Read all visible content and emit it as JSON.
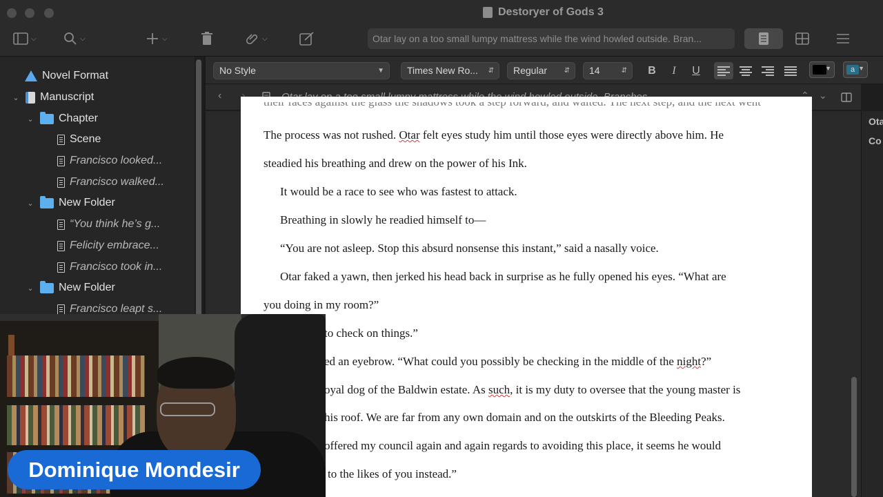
{
  "window": {
    "title": "Destoryer of Gods 3",
    "search_text": "Otar lay on a too small lumpy mattress while the wind howled outside. Bran..."
  },
  "toolbar": {
    "icons": [
      "sidebar-icon",
      "search-icon",
      "add-icon",
      "trash-icon",
      "paperclip-icon",
      "compose-icon",
      "document-view-icon",
      "grid-view-icon",
      "outline-view-icon"
    ]
  },
  "binder": {
    "items": [
      {
        "label": "Novel Format",
        "kind": "format"
      },
      {
        "label": "Manuscript",
        "kind": "manuscript"
      },
      {
        "label": "Chapter",
        "kind": "folder"
      },
      {
        "label": "Scene",
        "kind": "page"
      },
      {
        "label": "Francisco looked...",
        "kind": "page"
      },
      {
        "label": "Francisco walked...",
        "kind": "page"
      },
      {
        "label": "New Folder",
        "kind": "folder"
      },
      {
        "label": "“You think he’s g...",
        "kind": "page"
      },
      {
        "label": "Felicity embrace...",
        "kind": "page"
      },
      {
        "label": "Francisco took in...",
        "kind": "page"
      },
      {
        "label": "New Folder",
        "kind": "folder"
      },
      {
        "label": "Francisco leapt s...",
        "kind": "page"
      }
    ]
  },
  "format_bar": {
    "style": "No Style",
    "font": "Times New Ro...",
    "weight": "Regular",
    "size": "14",
    "bold": "B",
    "italic": "I",
    "underline": "U",
    "highlight_label": "a",
    "text_color": "#000000",
    "highlight_color": "#2a6f8a"
  },
  "header_bar": {
    "title": "Otar lay on a too small lumpy mattress while the wind howled outside. Branches..."
  },
  "editor": {
    "lines": [
      {
        "text": "The process was not rushed. ",
        "spell": "Otar",
        "rest": " felt eyes study him until those eyes were directly above him. He",
        "indent": false
      },
      {
        "text": "steadied his breathing and drew on the power of his Ink.",
        "indent": false
      },
      {
        "text": "It would be a race to see who was fastest to attack.",
        "indent": true
      },
      {
        "text": "Breathing in slowly he readied himself to—",
        "indent": true
      },
      {
        "text": "“You are not asleep. Stop this absurd nonsense this instant,” said a nasally voice.",
        "indent": true
      },
      {
        "text": "Otar faked a yawn, then jerked his head back in surprise as he fully opened his eyes. “What are",
        "indent": true
      },
      {
        "text": "you doing in my room?”",
        "indent": false
      },
      {
        "text": "to check on things.”",
        "indent": false
      },
      {
        "text": "ed an eyebrow. “What could you possibly be checking in the middle of the ",
        "spell": "night",
        "rest": "?”",
        "indent": false
      },
      {
        "text": "oyal dog of the Baldwin estate. As ",
        "spell": "such",
        "rest": ", it is my duty to oversee that the young master is",
        "indent": false
      },
      {
        "text": "his roof. We are far from any own domain and on the outskirts of the Bleeding Peaks.",
        "indent": false
      },
      {
        "text": "offered my council again and again regards to avoiding this place, it seems he would",
        "indent": false
      },
      {
        "text": "to the likes of you instead.”",
        "indent": false
      }
    ]
  },
  "inspector": {
    "label1": "Ota",
    "label2": "Co"
  },
  "webcam": {
    "name": "Dominique Mondesir"
  }
}
